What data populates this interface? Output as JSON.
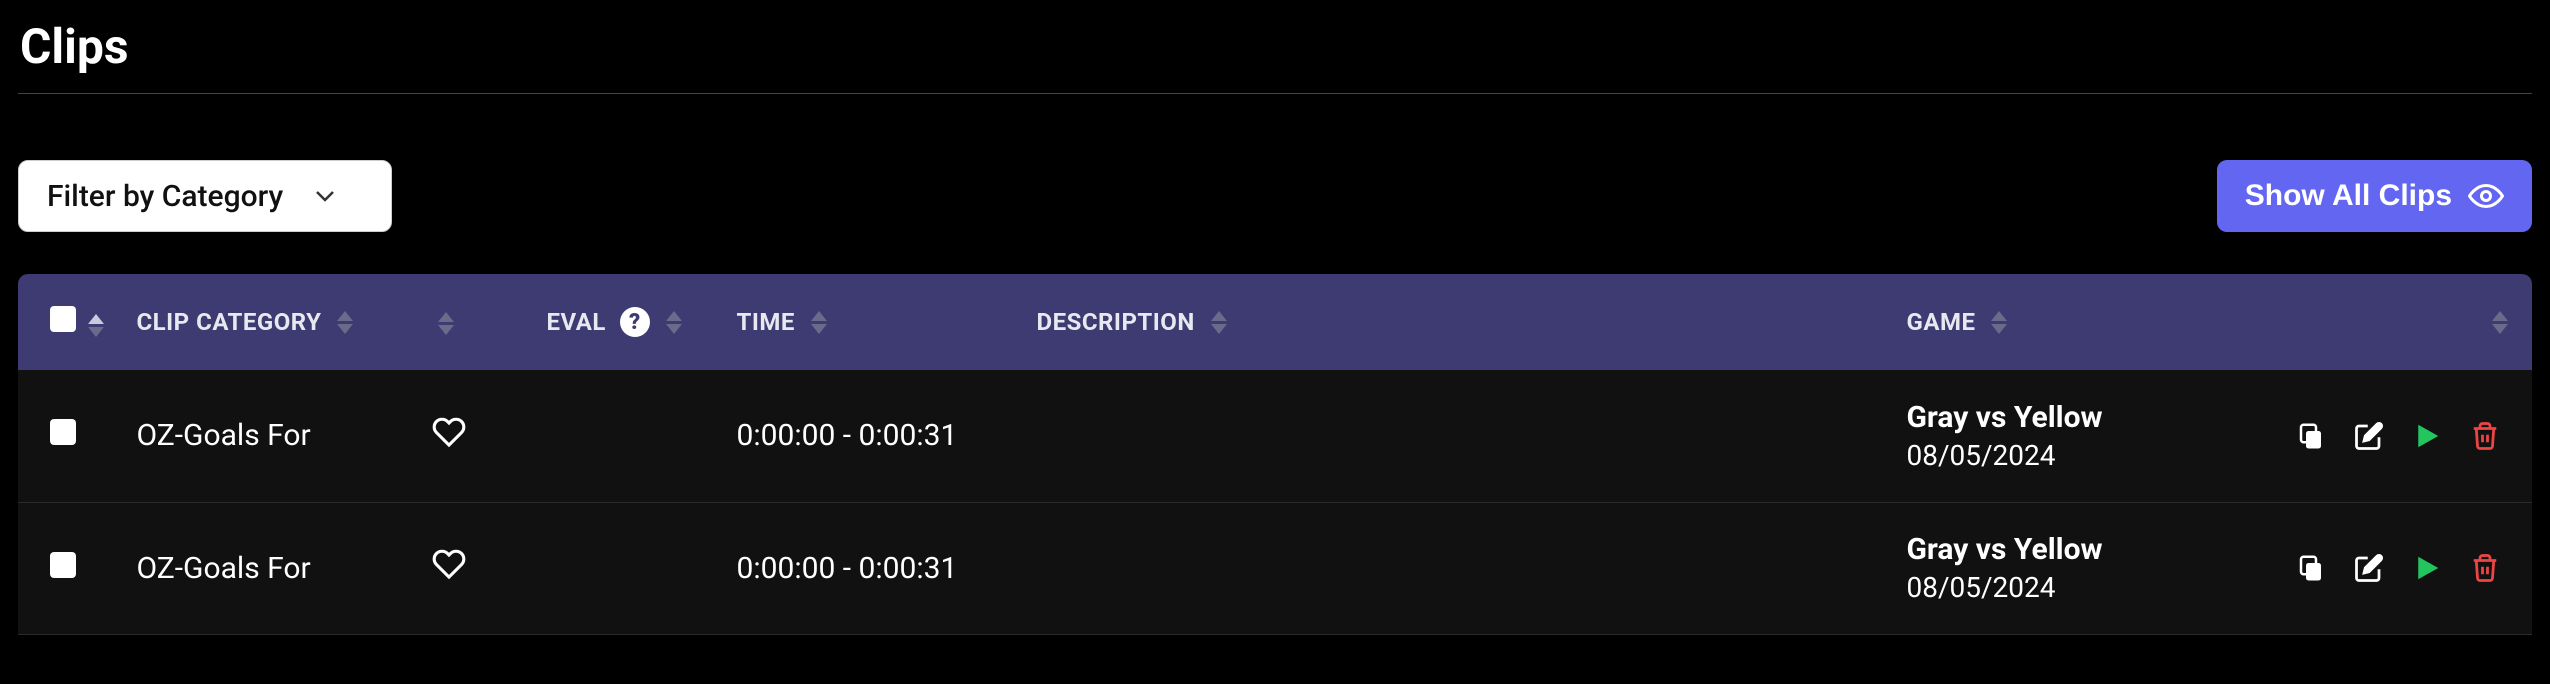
{
  "page": {
    "title": "Clips"
  },
  "toolbar": {
    "filter_label": "Filter by Category",
    "show_all_label": "Show All Clips"
  },
  "table": {
    "headers": {
      "category": "CLIP CATEGORY",
      "eval": "EVAL",
      "time": "TIME",
      "description": "DESCRIPTION",
      "game": "GAME"
    },
    "rows": [
      {
        "category": "OZ-Goals For",
        "favorite": false,
        "eval": "",
        "time": "0:00:00 - 0:00:31",
        "description": "",
        "game_name": "Gray vs Yellow",
        "game_date": "08/05/2024"
      },
      {
        "category": "OZ-Goals For",
        "favorite": false,
        "eval": "",
        "time": "0:00:00 - 0:00:31",
        "description": "",
        "game_name": "Gray vs Yellow",
        "game_date": "08/05/2024"
      }
    ]
  },
  "colors": {
    "accent": "#6366f1",
    "header_bg": "#3e3a72",
    "play": "#22c55e",
    "delete": "#ef4444"
  }
}
